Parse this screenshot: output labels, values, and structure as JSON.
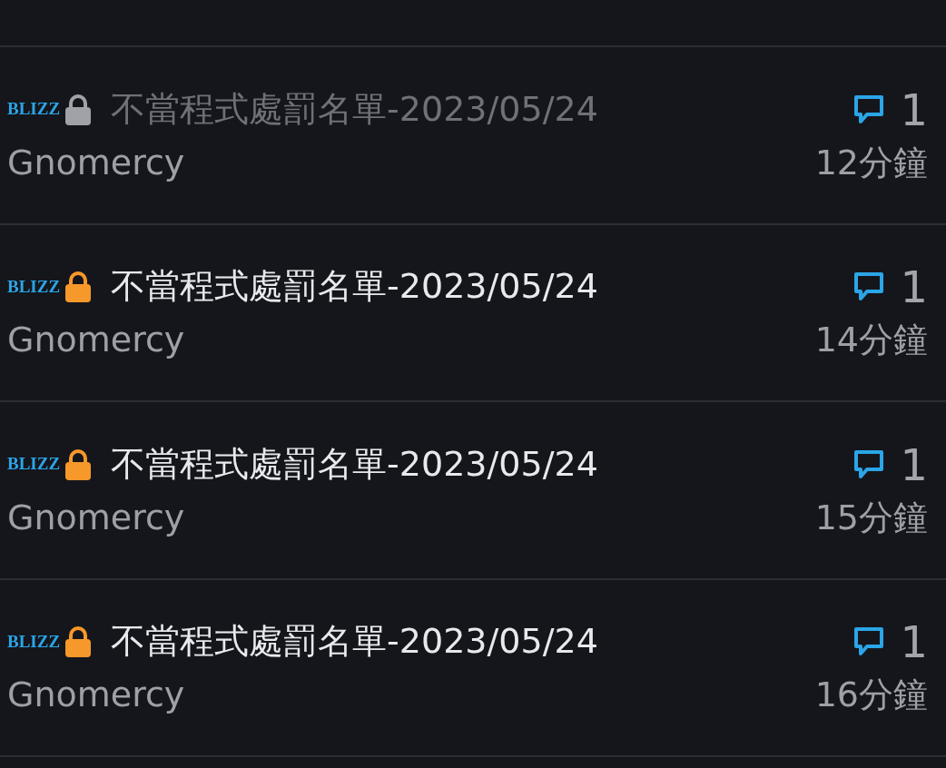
{
  "topics": [
    {
      "badge": "BLIZZ",
      "title": "不當程式處罰名單-2023/05/24",
      "read": true,
      "author": "Gnomercy",
      "replies": "1",
      "time": "12分鐘"
    },
    {
      "badge": "BLIZZ",
      "title": "不當程式處罰名單-2023/05/24",
      "read": false,
      "author": "Gnomercy",
      "replies": "1",
      "time": "14分鐘"
    },
    {
      "badge": "BLIZZ",
      "title": "不當程式處罰名單-2023/05/24",
      "read": false,
      "author": "Gnomercy",
      "replies": "1",
      "time": "15分鐘"
    },
    {
      "badge": "BLIZZ",
      "title": "不當程式處罰名單-2023/05/24",
      "read": false,
      "author": "Gnomercy",
      "replies": "1",
      "time": "16分鐘"
    }
  ]
}
